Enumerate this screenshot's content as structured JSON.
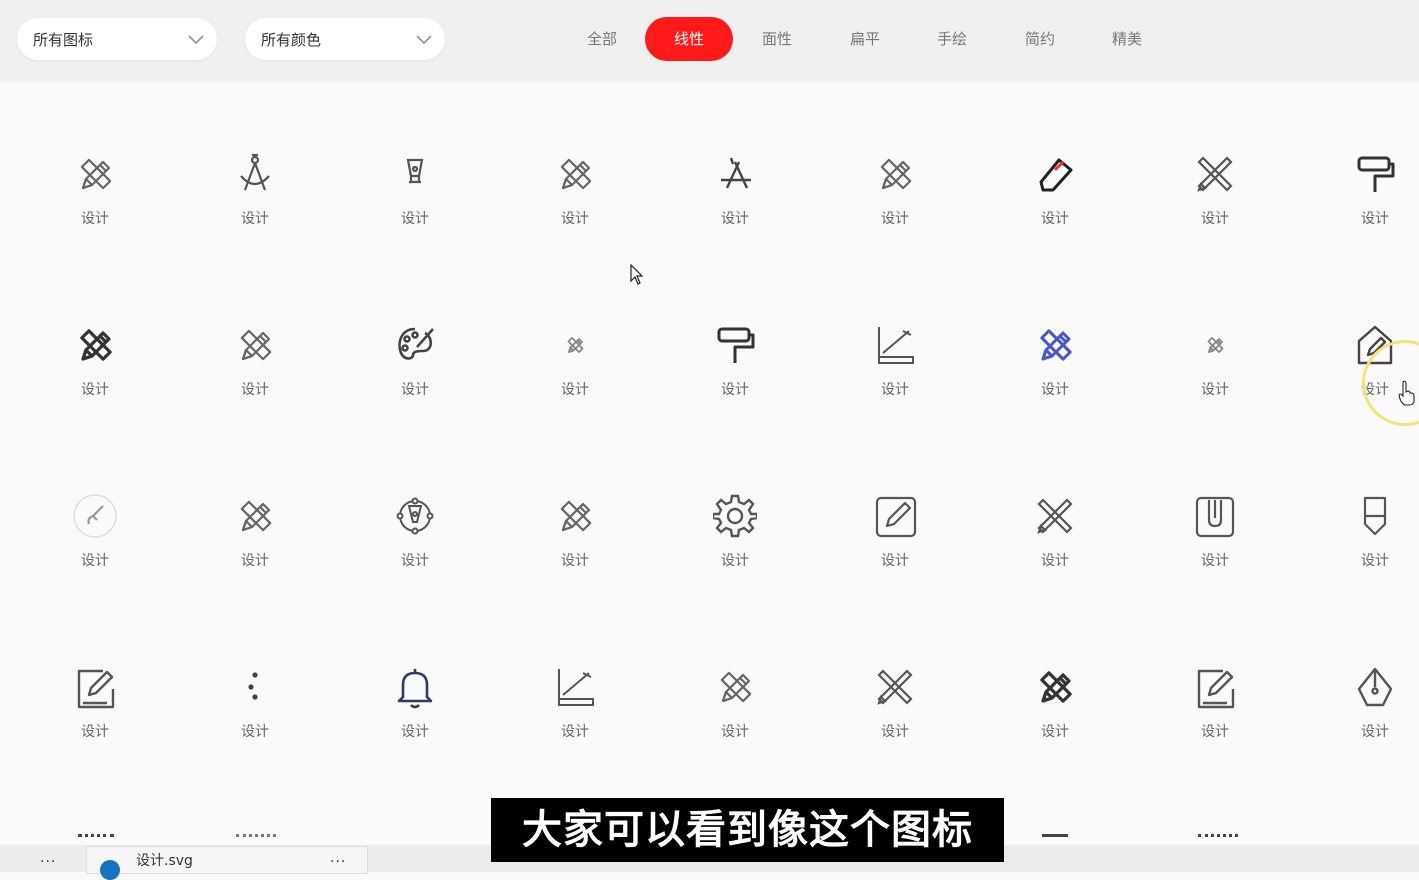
{
  "filters": {
    "icons_select": "所有图标",
    "colors_select": "所有颜色"
  },
  "tabs": [
    "全部",
    "线性",
    "面性",
    "扁平",
    "手绘",
    "简约",
    "精美"
  ],
  "active_tab": "线性",
  "colors": {
    "accent": "#ff1a1a",
    "icon_gray": "#666666",
    "icon_blue": "#4a57c8",
    "icon_navy": "#2c3a66"
  },
  "grid": {
    "rows": [
      [
        {
          "label": "设计",
          "icon": "pencil-ruler-icon"
        },
        {
          "label": "设计",
          "icon": "compass-icon"
        },
        {
          "label": "设计",
          "icon": "pen-nib-icon"
        },
        {
          "label": "设计",
          "icon": "pencil-ruler-icon"
        },
        {
          "label": "设计",
          "icon": "app-store-a-icon"
        },
        {
          "label": "设计",
          "icon": "pencil-ruler-icon"
        },
        {
          "label": "设计",
          "icon": "eraser-pen-icon"
        },
        {
          "label": "设计",
          "icon": "pencil-ruler-cross-icon"
        },
        {
          "label": "设计",
          "icon": "paint-roller-icon"
        }
      ],
      [
        {
          "label": "设计",
          "icon": "pencil-ruler-bold-icon"
        },
        {
          "label": "设计",
          "icon": "pencil-ruler-icon"
        },
        {
          "label": "设计",
          "icon": "palette-icon"
        },
        {
          "label": "设计",
          "icon": "pencil-ruler-small-icon"
        },
        {
          "label": "设计",
          "icon": "paint-roller-icon"
        },
        {
          "label": "设计",
          "icon": "ruler-pencil-chart-icon"
        },
        {
          "label": "设计",
          "icon": "pencil-ruler-blue-icon"
        },
        {
          "label": "设计",
          "icon": "pencil-ruler-small-icon"
        },
        {
          "label": "设计",
          "icon": "house-pencil-icon"
        }
      ],
      [
        {
          "label": "设计",
          "icon": "brush-circle-icon"
        },
        {
          "label": "设计",
          "icon": "pencil-ruler-icon"
        },
        {
          "label": "设计",
          "icon": "pen-tool-nodes-icon"
        },
        {
          "label": "设计",
          "icon": "pencil-ruler-icon"
        },
        {
          "label": "设计",
          "icon": "gear-icon"
        },
        {
          "label": "设计",
          "icon": "edit-square-icon"
        },
        {
          "label": "设计",
          "icon": "pencil-ruler-cross-icon"
        },
        {
          "label": "设计",
          "icon": "clip-box-icon"
        },
        {
          "label": "设计",
          "icon": "pen-marker-icon"
        }
      ],
      [
        {
          "label": "设计",
          "icon": "edit-note-icon"
        },
        {
          "label": "设计",
          "icon": "dots-icon"
        },
        {
          "label": "设计",
          "icon": "bell-icon"
        },
        {
          "label": "设计",
          "icon": "ruler-pencil-chart-icon"
        },
        {
          "label": "设计",
          "icon": "pencil-ruler-icon"
        },
        {
          "label": "设计",
          "icon": "pencil-ruler-cross-icon"
        },
        {
          "label": "设计",
          "icon": "pencil-ruler-bold-icon"
        },
        {
          "label": "设计",
          "icon": "edit-note-icon"
        },
        {
          "label": "设计",
          "icon": "pen-nib-shape-icon"
        }
      ]
    ]
  },
  "taskbar": {
    "file_name": "设计.svg",
    "dots": "..."
  },
  "subtitle": "大家可以看到像这个图标"
}
